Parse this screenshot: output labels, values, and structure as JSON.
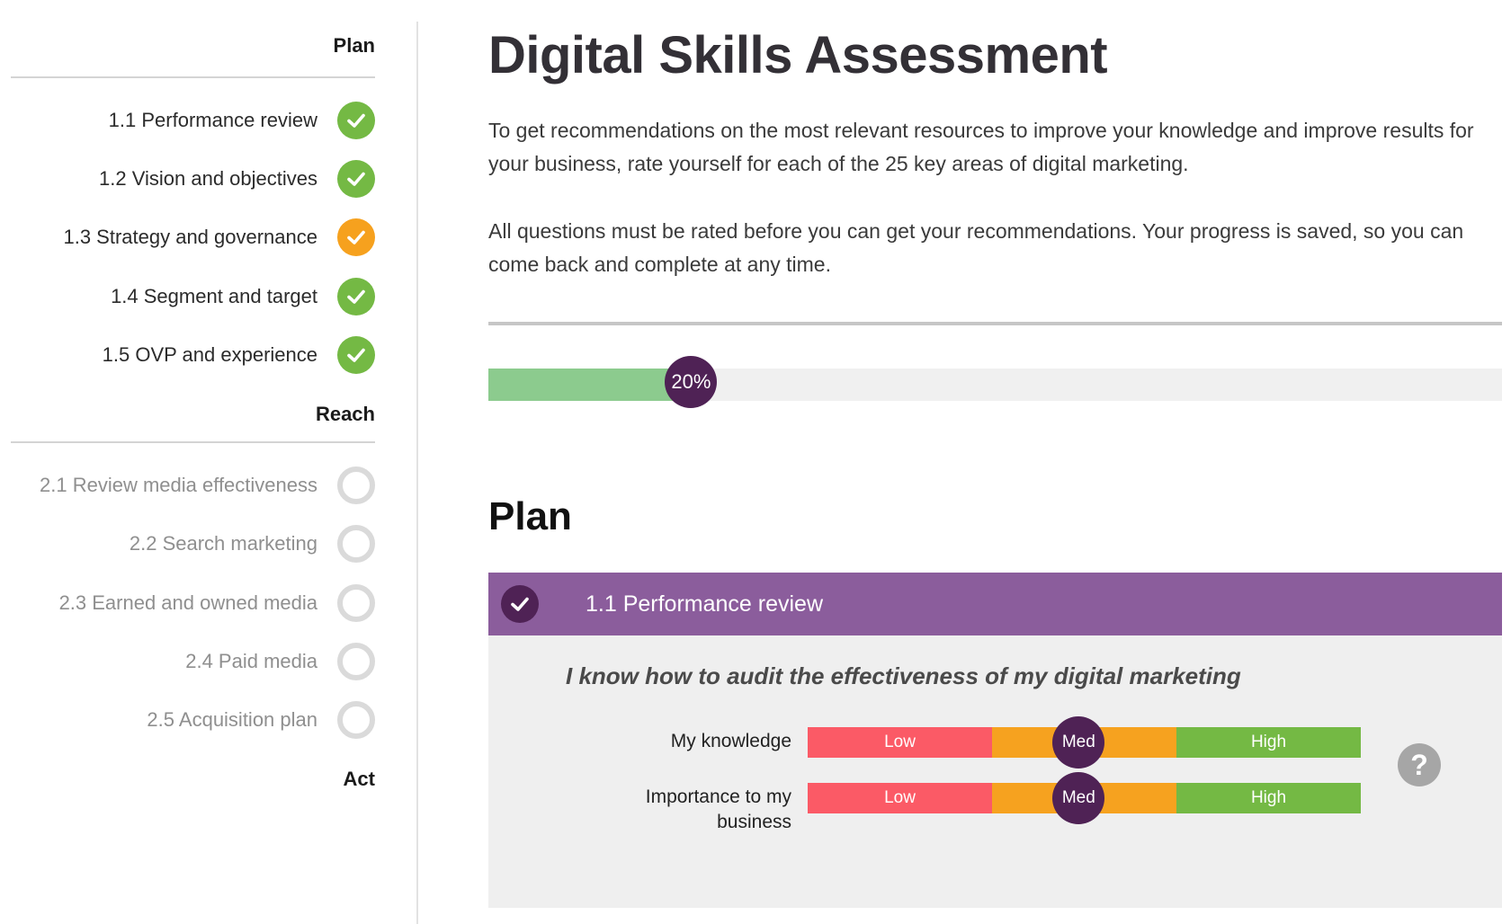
{
  "sidebar": {
    "sections": [
      {
        "title": "Plan",
        "items": [
          {
            "label": "1.1 Performance review",
            "status": "complete"
          },
          {
            "label": "1.2 Vision and objectives",
            "status": "complete"
          },
          {
            "label": "1.3 Strategy and governance",
            "status": "partial"
          },
          {
            "label": "1.4 Segment and target",
            "status": "complete"
          },
          {
            "label": "1.5 OVP and experience",
            "status": "complete"
          }
        ]
      },
      {
        "title": "Reach",
        "items": [
          {
            "label": "2.1 Review media effectiveness",
            "status": "not-started"
          },
          {
            "label": "2.2 Search marketing",
            "status": "not-started"
          },
          {
            "label": "2.3 Earned and owned media",
            "status": "not-started"
          },
          {
            "label": "2.4 Paid media",
            "status": "not-started"
          },
          {
            "label": "2.5 Acquisition plan",
            "status": "not-started"
          }
        ]
      },
      {
        "title": "Act",
        "items": []
      }
    ]
  },
  "main": {
    "title": "Digital Skills Assessment",
    "intro_paragraph_1": "To get recommendations on the most relevant resources to improve your knowledge and improve results for your business, rate yourself for each of the 25 key areas of digital marketing.",
    "intro_paragraph_2": "All questions must be rated before you can get your recommendations. Your progress is saved, so you can come back and complete at any time.",
    "progress": {
      "percent": 20,
      "label": "20%"
    },
    "section_title": "Plan",
    "card": {
      "title": "1.1 Performance review",
      "question": "I know how to audit the effectiveness of my digital marketing",
      "ratings": [
        {
          "label": "My knowledge",
          "low_label": "Low",
          "med_label": "Med",
          "high_label": "High",
          "selected": "Med",
          "selected_position": 0.49
        },
        {
          "label": "Importance to my business",
          "low_label": "Low",
          "med_label": "Med",
          "high_label": "High",
          "selected": "Med",
          "selected_position": 0.49
        }
      ],
      "help_label": "?"
    }
  },
  "colors": {
    "complete": "#74b944",
    "partial": "#f6a11e",
    "not_started": "#dadada",
    "accent_purple": "#8b5d9c",
    "dark_purple": "#4f2255",
    "progress_fill": "#8ccb8e",
    "low": "#fb5a66",
    "med": "#f6a21f",
    "high": "#74b944"
  }
}
